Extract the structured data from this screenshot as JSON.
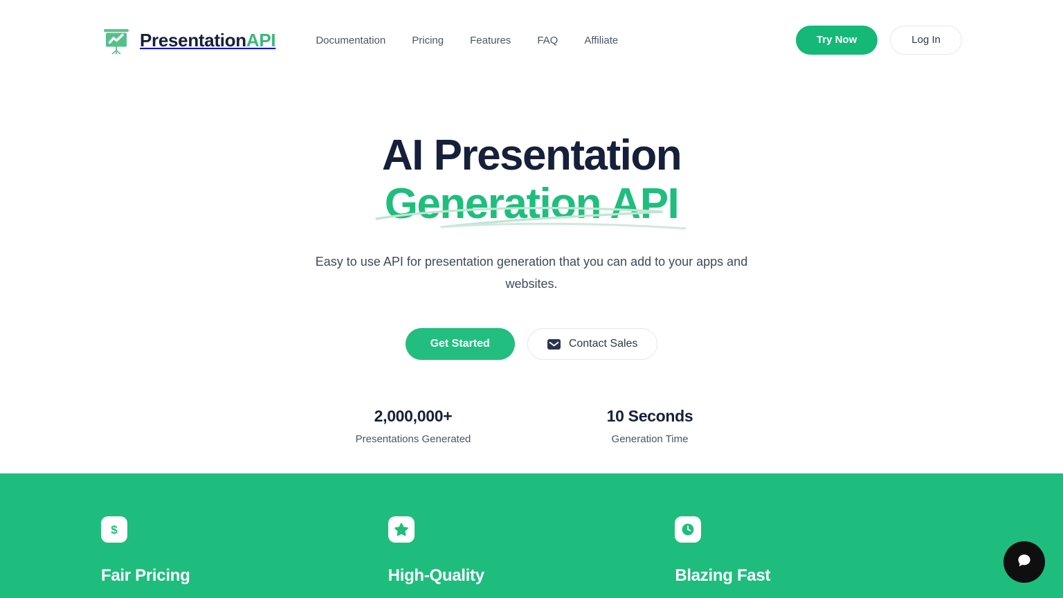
{
  "brand": {
    "name_dark": "Presentation",
    "name_green": "API",
    "logo_icon": "presentation-chart-icon"
  },
  "nav": {
    "items": [
      {
        "label": "Documentation"
      },
      {
        "label": "Pricing"
      },
      {
        "label": "Features"
      },
      {
        "label": "FAQ"
      },
      {
        "label": "Affiliate"
      }
    ]
  },
  "header_actions": {
    "try_now": "Try Now",
    "log_in": "Log In"
  },
  "hero": {
    "title_line1": "AI Presentation",
    "title_line2": "Generation API",
    "subtitle": "Easy to use API for presentation generation that you can add to your apps and websites.",
    "cta_primary": "Get Started",
    "cta_secondary": "Contact Sales",
    "cta_secondary_icon": "mail-icon"
  },
  "stats": [
    {
      "value": "2,000,000+",
      "label": "Presentations Generated"
    },
    {
      "value": "10 Seconds",
      "label": "Generation Time"
    }
  ],
  "features": [
    {
      "title": "Fair Pricing",
      "icon": "dollar-sign-icon"
    },
    {
      "title": "High-Quality",
      "icon": "star-icon"
    },
    {
      "title": "Blazing Fast",
      "icon": "clock-icon"
    }
  ],
  "chat": {
    "icon": "chat-bubble-icon"
  },
  "colors": {
    "brand_green": "#1ebd7e",
    "button_green": "#22be7f",
    "logo_green": "#3cb878",
    "heading_navy": "#16203a",
    "body_gray": "#4a5568",
    "chat_black": "#0f0f10"
  }
}
